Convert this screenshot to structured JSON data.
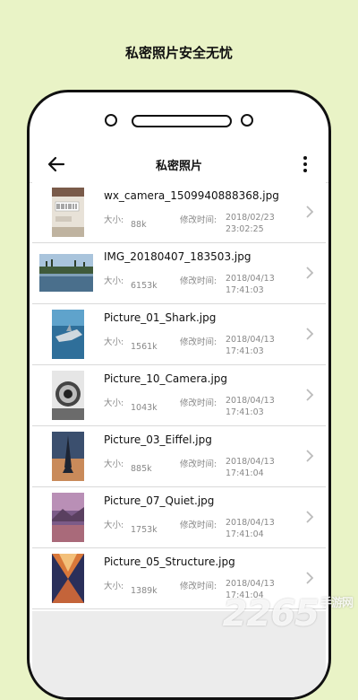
{
  "promo": {
    "title": "私密照片安全无忧"
  },
  "appbar": {
    "title": "私密照片"
  },
  "labels": {
    "size": "大小:",
    "mtime": "修改时间:"
  },
  "files": [
    {
      "name": "wx_camera_1509940888368.jpg",
      "size": "88k",
      "date": "2018/02/23",
      "time": "23:02:25"
    },
    {
      "name": "IMG_20180407_183503.jpg",
      "size": "6153k",
      "date": "2018/04/13",
      "time": "17:41:03"
    },
    {
      "name": "Picture_01_Shark.jpg",
      "size": "1561k",
      "date": "2018/04/13",
      "time": "17:41:03"
    },
    {
      "name": "Picture_10_Camera.jpg",
      "size": "1043k",
      "date": "2018/04/13",
      "time": "17:41:03"
    },
    {
      "name": "Picture_03_Eiffel.jpg",
      "size": "885k",
      "date": "2018/04/13",
      "time": "17:41:04"
    },
    {
      "name": "Picture_07_Quiet.jpg",
      "size": "1753k",
      "date": "2018/04/13",
      "time": "17:41:04"
    },
    {
      "name": "Picture_05_Structure.jpg",
      "size": "1389k",
      "date": "2018/04/13",
      "time": "17:41:04"
    }
  ],
  "watermark": {
    "number": "2265",
    "suffix": "手游网"
  }
}
